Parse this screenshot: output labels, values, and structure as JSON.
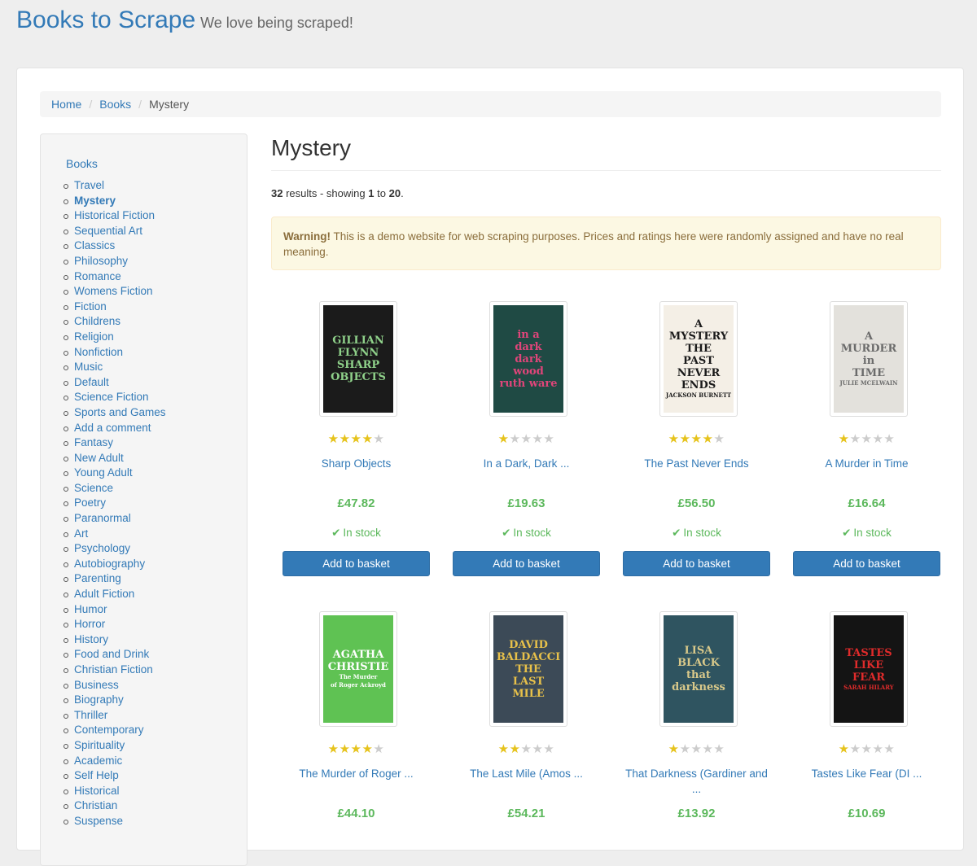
{
  "header": {
    "title": "Books to Scrape",
    "tagline": "We love being scraped!"
  },
  "breadcrumb": {
    "home": "Home",
    "books": "Books",
    "current": "Mystery"
  },
  "sidebar": {
    "root_label": "Books",
    "categories": [
      "Travel",
      "Mystery",
      "Historical Fiction",
      "Sequential Art",
      "Classics",
      "Philosophy",
      "Romance",
      "Womens Fiction",
      "Fiction",
      "Childrens",
      "Religion",
      "Nonfiction",
      "Music",
      "Default",
      "Science Fiction",
      "Sports and Games",
      "Add a comment",
      "Fantasy",
      "New Adult",
      "Young Adult",
      "Science",
      "Poetry",
      "Paranormal",
      "Art",
      "Psychology",
      "Autobiography",
      "Parenting",
      "Adult Fiction",
      "Humor",
      "Horror",
      "History",
      "Food and Drink",
      "Christian Fiction",
      "Business",
      "Biography",
      "Thriller",
      "Contemporary",
      "Spirituality",
      "Academic",
      "Self Help",
      "Historical",
      "Christian",
      "Suspense"
    ],
    "active": "Mystery"
  },
  "main": {
    "title": "Mystery",
    "results_total": "32",
    "results_text": "results - showing",
    "results_from": "1",
    "results_to_word": "to",
    "results_to": "20",
    "results_end": ".",
    "warning_label": "Warning!",
    "warning_text": "This is a demo website for web scraping purposes. Prices and ratings here were randomly assigned and have no real meaning."
  },
  "labels": {
    "in_stock": "In stock",
    "add_to_basket": "Add to basket",
    "check_icon": "check-icon"
  },
  "books": [
    {
      "title": "Sharp Objects",
      "price": "£47.82",
      "rating": 4,
      "in_stock": true,
      "cover": {
        "bg": "#1b1b1b",
        "fg": "#8fd18a",
        "lines": [
          "GILLIAN",
          "FLYNN",
          "SHARP",
          "OBJECTS"
        ]
      }
    },
    {
      "title": "In a Dark, Dark ...",
      "price": "£19.63",
      "rating": 1,
      "in_stock": true,
      "cover": {
        "bg": "#1f4a44",
        "fg": "#e0457a",
        "lines": [
          "in a",
          "dark",
          "dark",
          "wood",
          "ruth ware"
        ]
      }
    },
    {
      "title": "The Past Never Ends",
      "price": "£56.50",
      "rating": 4,
      "in_stock": true,
      "cover": {
        "bg": "#f4efe6",
        "fg": "#1a1a1a",
        "lines": [
          "A MYSTERY",
          "THE",
          "PAST",
          "NEVER",
          "ENDS",
          "JACKSON BURNETT"
        ]
      }
    },
    {
      "title": "A Murder in Time",
      "price": "£16.64",
      "rating": 1,
      "in_stock": true,
      "cover": {
        "bg": "#e3e1dc",
        "fg": "#6b6b6b",
        "lines": [
          "A",
          "MURDER",
          "in",
          "TIME",
          "JULIE MCELWAIN"
        ]
      }
    },
    {
      "title": "The Murder of Roger ...",
      "price": "£44.10",
      "rating": 4,
      "in_stock": true,
      "cover": {
        "bg": "#5fc253",
        "fg": "#ffffff",
        "lines": [
          "AGATHA",
          "CHRISTIE",
          "The Murder",
          "of Roger Ackroyd"
        ]
      }
    },
    {
      "title": "The Last Mile (Amos ...",
      "price": "£54.21",
      "rating": 2,
      "in_stock": true,
      "cover": {
        "bg": "#3c4a57",
        "fg": "#e8c14a",
        "lines": [
          "DAVID",
          "BALDACCI",
          "THE",
          "LAST",
          "MILE"
        ]
      }
    },
    {
      "title": "That Darkness (Gardiner and ...",
      "price": "£13.92",
      "rating": 1,
      "in_stock": true,
      "cover": {
        "bg": "#2f5460",
        "fg": "#d9c98a",
        "lines": [
          "LISA",
          "BLACK",
          "that",
          "darkness"
        ]
      }
    },
    {
      "title": "Tastes Like Fear (DI ...",
      "price": "£10.69",
      "rating": 1,
      "in_stock": true,
      "cover": {
        "bg": "#141414",
        "fg": "#e02b2b",
        "lines": [
          "TASTES",
          "LIKE",
          "FEAR",
          "SARAH HILARY"
        ]
      }
    }
  ],
  "colors": {
    "link": "#337ab7",
    "price": "#5cb85c",
    "star_on": "#e6c31c",
    "star_off": "#cccccc",
    "button": "#337ab7"
  }
}
